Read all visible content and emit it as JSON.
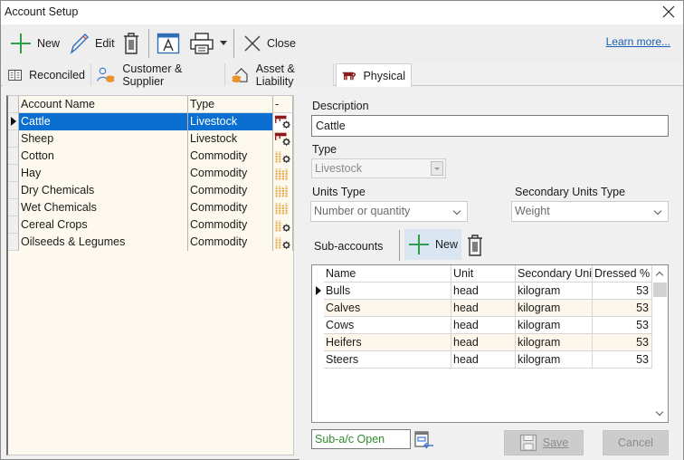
{
  "window": {
    "title": "Account Setup"
  },
  "toolbar": {
    "new_label": "New",
    "edit_label": "Edit",
    "close_label": "Close",
    "learn_more": "Learn more..."
  },
  "tabs": [
    {
      "label": "Reconciled",
      "icon": "ledger-book-icon"
    },
    {
      "label": "Customer & Supplier",
      "icon": "people-coins-icon"
    },
    {
      "label": "Asset & Liability",
      "icon": "house-coins-icon"
    },
    {
      "label": "Physical",
      "icon": "cow-icon",
      "active": true
    }
  ],
  "accounts": {
    "columns": [
      "Account Name",
      "Type",
      "-"
    ],
    "rows": [
      {
        "name": "Cattle",
        "type": "Livestock",
        "icon": "livestock-gear-icon",
        "selected": true
      },
      {
        "name": "Sheep",
        "type": "Livestock",
        "icon": "livestock-gear-icon"
      },
      {
        "name": "Cotton",
        "type": "Commodity",
        "icon": "commodity-gear-icon"
      },
      {
        "name": "Hay",
        "type": "Commodity",
        "icon": "commodity-icon"
      },
      {
        "name": "Dry Chemicals",
        "type": "Commodity",
        "icon": "commodity-icon"
      },
      {
        "name": "Wet Chemicals",
        "type": "Commodity",
        "icon": "commodity-icon"
      },
      {
        "name": "Cereal Crops",
        "type": "Commodity",
        "icon": "commodity-gear-icon"
      },
      {
        "name": "Oilseeds & Legumes",
        "type": "Commodity",
        "icon": "commodity-gear-icon"
      }
    ]
  },
  "details": {
    "description_label": "Description",
    "description_value": "Cattle",
    "type_label": "Type",
    "type_value": "Livestock",
    "units_type_label": "Units Type",
    "units_type_value": "Number or quantity",
    "secondary_units_type_label": "Secondary Units Type",
    "secondary_units_type_value": "Weight"
  },
  "subaccounts": {
    "label": "Sub-accounts",
    "new_label": "New",
    "columns": [
      "Name",
      "Unit",
      "Secondary Unit",
      "Dressed %"
    ],
    "rows": [
      {
        "name": "Bulls",
        "unit": "head",
        "secondary_unit": "kilogram",
        "dressed": "53",
        "current": true
      },
      {
        "name": "Calves",
        "unit": "head",
        "secondary_unit": "kilogram",
        "dressed": "53"
      },
      {
        "name": "Cows",
        "unit": "head",
        "secondary_unit": "kilogram",
        "dressed": "53"
      },
      {
        "name": "Heifers",
        "unit": "head",
        "secondary_unit": "kilogram",
        "dressed": "53"
      },
      {
        "name": "Steers",
        "unit": "head",
        "secondary_unit": "kilogram",
        "dressed": "53"
      }
    ],
    "status": "Sub-a/c Open"
  },
  "footer": {
    "save_label": "Save",
    "cancel_label": "Cancel"
  },
  "colors": {
    "selection": "#0a6fd1",
    "link": "#1a5fb4",
    "status_text": "#2e8b2e",
    "grid_bg": "#fdf9ee"
  }
}
